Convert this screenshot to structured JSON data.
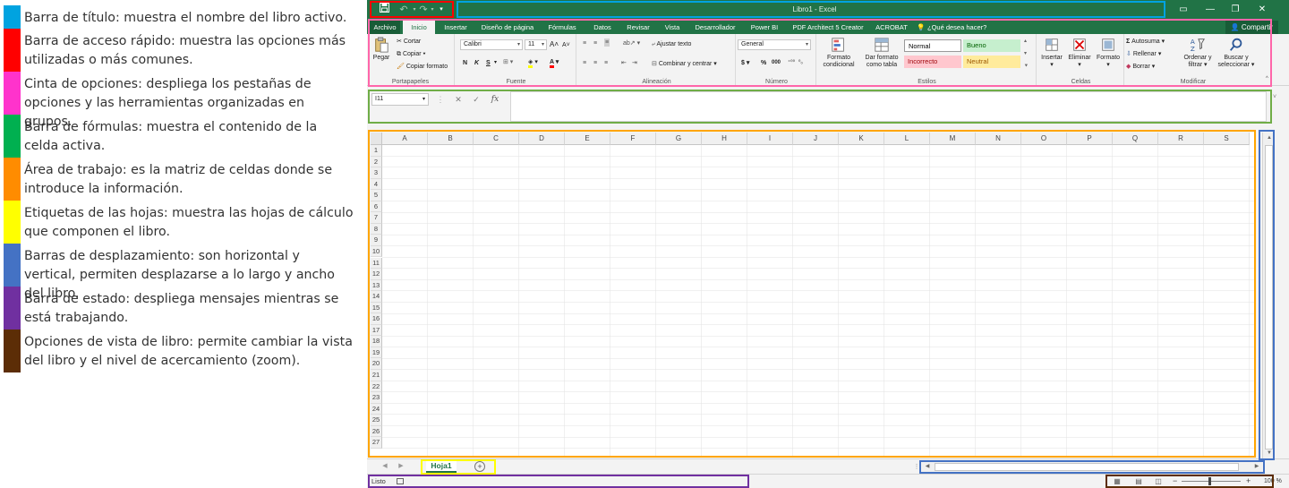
{
  "legend": [
    {
      "color": "#00a3e0",
      "text": "Barra de título: muestra el nombre del libro activo."
    },
    {
      "color": "#ff0000",
      "text": "Barra de acceso rápido: muestra las opciones más utilizadas o más comunes."
    },
    {
      "color": "#ff33cc",
      "text": "Cinta de opciones: despliega los pestañas de opciones y las herramientas organizadas en grupos."
    },
    {
      "color": "#00b050",
      "text": "Barra de fórmulas: muestra el contenido de la celda activa."
    },
    {
      "color": "#ff8c00",
      "text": "Área de trabajo: es la matriz de celdas donde se introduce la información."
    },
    {
      "color": "#ffff00",
      "text": "Etiquetas de las hojas: muestra las hojas de cálculo que componen el libro."
    },
    {
      "color": "#4472c4",
      "text": "Barras de desplazamiento: son horizontal y vertical, permiten desplazarse a lo largo y ancho del libro."
    },
    {
      "color": "#7030a0",
      "text": "Barra de estado: despliega mensajes mientras se está trabajando."
    },
    {
      "color": "#5c2d06",
      "text": "Opciones de vista de libro: permite cambiar la vista del libro y el nivel de acercamiento (zoom)."
    }
  ],
  "excel": {
    "title": "Libro1 - Excel",
    "tabs": [
      "Archivo",
      "Inicio",
      "Insertar",
      "Diseño de página",
      "Fórmulas",
      "Datos",
      "Revisar",
      "Vista",
      "Desarrollador",
      "Power BI",
      "PDF Architect 5 Creator",
      "ACROBAT"
    ],
    "tell_me": "¿Qué desea hacer?",
    "share": "Compartir",
    "clipboard": {
      "paste": "Pegar",
      "cut": "Cortar",
      "copy": "Copiar",
      "format_painter": "Copiar formato",
      "label": "Portapapeles"
    },
    "font": {
      "name": "Calibri",
      "size": "11",
      "bold": "N",
      "italic": "K",
      "underline": "S",
      "label": "Fuente"
    },
    "alignment": {
      "wrap": "Ajustar texto",
      "merge": "Combinar y centrar",
      "label": "Alineación"
    },
    "number": {
      "format": "General",
      "currency": "$",
      "percent": "%",
      "thousands": "000",
      "label": "Número"
    },
    "styles": {
      "conditional": "Formato condicional",
      "as_table": "Dar formato como tabla",
      "normal": "Normal",
      "good": "Bueno",
      "bad": "Incorrecto",
      "neutral": "Neutral",
      "label": "Estilos"
    },
    "cells": {
      "insert": "Insertar",
      "delete": "Eliminar",
      "format": "Formato",
      "label": "Celdas"
    },
    "editing": {
      "autosum": "Autosuma",
      "fill": "Rellenar",
      "clear": "Borrar",
      "sort": "Ordenar y filtrar",
      "find": "Buscar y seleccionar",
      "label": "Modificar"
    },
    "name_box": "I11",
    "fx": "fx",
    "columns": [
      "A",
      "B",
      "C",
      "D",
      "E",
      "F",
      "G",
      "H",
      "I",
      "J",
      "K",
      "L",
      "M",
      "N",
      "O",
      "P",
      "Q",
      "R",
      "S"
    ],
    "rows": [
      "1",
      "2",
      "3",
      "4",
      "5",
      "6",
      "7",
      "8",
      "9",
      "10",
      "11",
      "12",
      "13",
      "14",
      "15",
      "16",
      "17",
      "18",
      "19",
      "20",
      "21",
      "22",
      "23",
      "24",
      "25",
      "26",
      "27"
    ],
    "sheet_tab": "Hoja1",
    "status": "Listo",
    "zoom": "100 %"
  }
}
